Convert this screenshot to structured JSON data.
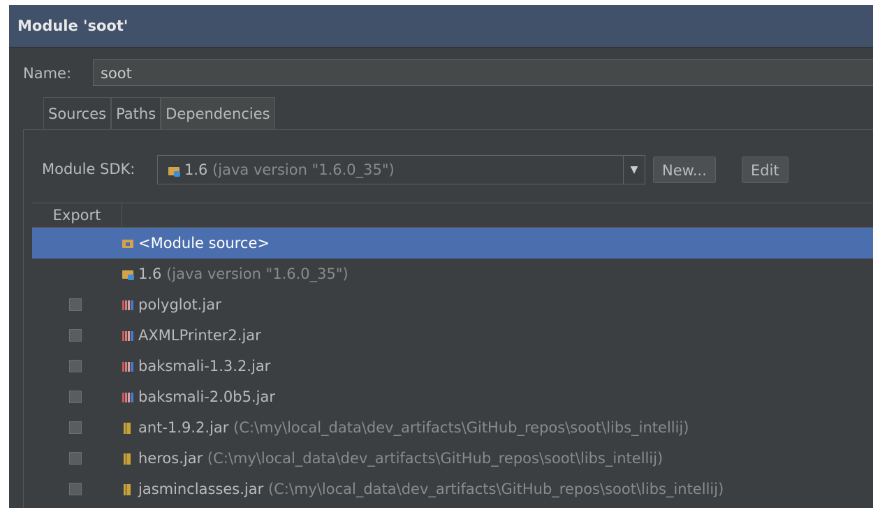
{
  "window": {
    "title": "Module 'soot'"
  },
  "name_field": {
    "label": "Name:",
    "value": "soot"
  },
  "tabs": [
    {
      "label": "Sources",
      "active": false
    },
    {
      "label": "Paths",
      "active": false
    },
    {
      "label": "Dependencies",
      "active": true
    }
  ],
  "sdk": {
    "label": "Module SDK:",
    "version": "1.6",
    "detail": "(java version \"1.6.0_35\")",
    "new_label": "New...",
    "edit_label": "Edit"
  },
  "table": {
    "export_header": "Export",
    "rows": [
      {
        "name": "<Module source>",
        "detail": "",
        "icon": "module-source-icon",
        "checkbox": false,
        "selected": true
      },
      {
        "name": "1.6",
        "detail": "(java version \"1.6.0_35\")",
        "icon": "sdk-icon",
        "checkbox": false,
        "selected": false
      },
      {
        "name": "polyglot.jar",
        "detail": "",
        "icon": "library-icon",
        "checkbox": true,
        "selected": false
      },
      {
        "name": "AXMLPrinter2.jar",
        "detail": "",
        "icon": "library-icon",
        "checkbox": true,
        "selected": false
      },
      {
        "name": "baksmali-1.3.2.jar",
        "detail": "",
        "icon": "library-icon",
        "checkbox": true,
        "selected": false
      },
      {
        "name": "baksmali-2.0b5.jar",
        "detail": "",
        "icon": "library-icon",
        "checkbox": true,
        "selected": false
      },
      {
        "name": "ant-1.9.2.jar",
        "detail": "(C:\\my\\local_data\\dev_artifacts\\GitHub_repos\\soot\\libs_intellij)",
        "icon": "jar-icon",
        "checkbox": true,
        "selected": false
      },
      {
        "name": "heros.jar",
        "detail": "(C:\\my\\local_data\\dev_artifacts\\GitHub_repos\\soot\\libs_intellij)",
        "icon": "jar-icon",
        "checkbox": true,
        "selected": false
      },
      {
        "name": "jasminclasses.jar",
        "detail": "(C:\\my\\local_data\\dev_artifacts\\GitHub_repos\\soot\\libs_intellij)",
        "icon": "jar-icon",
        "checkbox": true,
        "selected": false
      }
    ]
  }
}
